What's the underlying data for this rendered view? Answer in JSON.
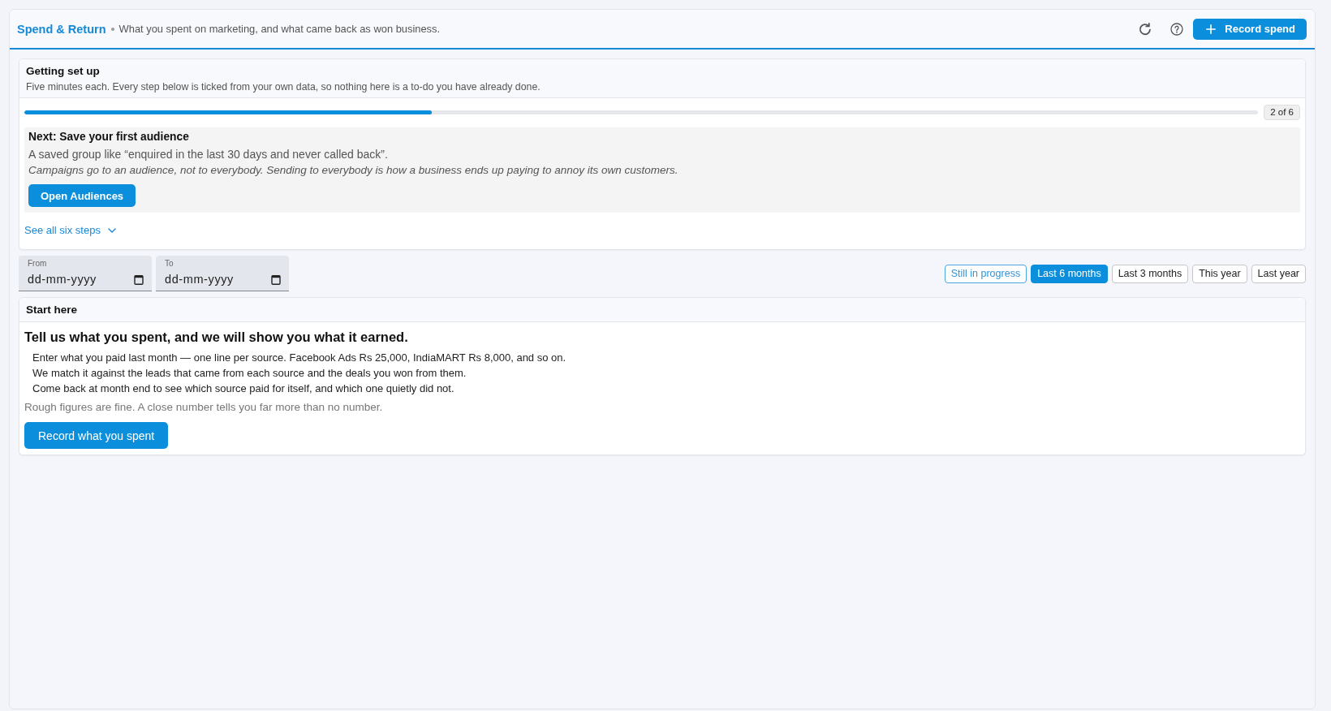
{
  "header": {
    "title": "Spend & Return",
    "subtitle": "What you spent on marketing, and what came back as won business.",
    "primary_button": "Record spend"
  },
  "setup": {
    "title": "Getting set up",
    "subtitle": "Five minutes each. Every step below is ticked from your own data, so nothing here is a to-do you have already done.",
    "progress": {
      "level": 0.33,
      "reading": "2 of 6"
    },
    "next_step": {
      "title": "Next: Save your first audience",
      "description": "A saved group like “enquired in the last 30 days and never called back”.",
      "note": "Campaigns go to an audience, not to everybody. Sending to everybody is how a business ends up paying to annoy its own customers.",
      "button": "Open Audiences"
    },
    "steps_link": {
      "label": "See all six steps",
      "expanded": false
    }
  },
  "date_range": [
    {
      "label": "From",
      "placeholder": "dd-mm-yyyy"
    },
    {
      "label": "To",
      "placeholder": "dd-mm-yyyy"
    }
  ],
  "period_filters": [
    {
      "label": "Still in progress",
      "kind": "status",
      "selected": false
    },
    {
      "label": "Last 6 months",
      "kind": "period",
      "selected": true
    },
    {
      "label": "Last 3 months",
      "kind": "period",
      "selected": false
    },
    {
      "label": "This year",
      "kind": "period",
      "selected": false
    },
    {
      "label": "Last year",
      "kind": "period",
      "selected": false
    }
  ],
  "start_card": {
    "title": "Start here",
    "headline": "Tell us what you spent, and we will show you what it earned.",
    "steps": [
      "Enter what you paid last month — one line per source. Facebook Ads Rs 25,000, IndiaMART Rs 8,000, and so on.",
      "We match it against the leads that came from each source and the deals you won from them.",
      "Come back at month end to see which source paid for itself, and which one quietly did not."
    ],
    "note": "Rough figures are fine. A close number tells you far more than no number.",
    "button": "Record what you spent"
  }
}
